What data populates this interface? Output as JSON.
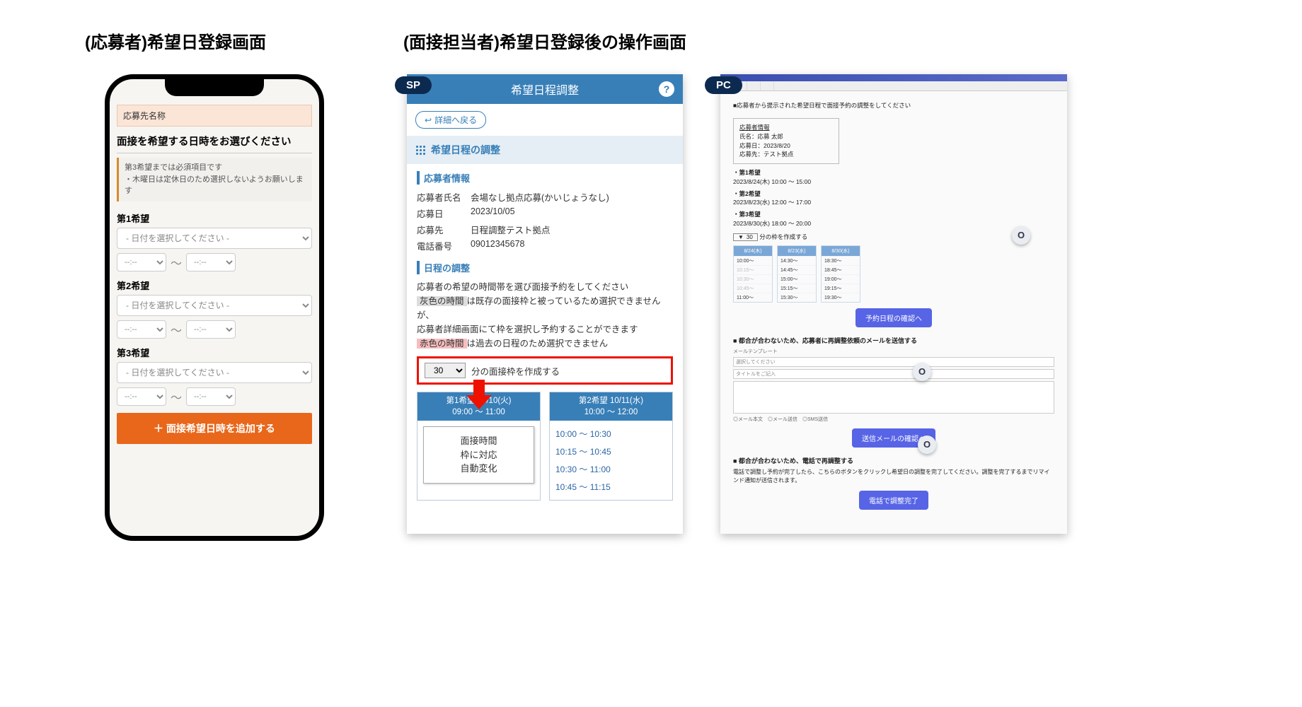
{
  "headings": {
    "left": "(応募者)希望日登録画面",
    "right": "(面接担当者)希望日登録後の操作画面"
  },
  "badges": {
    "sp": "SP",
    "pc": "PC"
  },
  "applicant_phone": {
    "dest_label": "応募先名称",
    "choose_title": "面接を希望する日時をお選びください",
    "notice_l1": "第3希望までは必須項目です",
    "notice_l2": "・木曜日は定休日のため選択しないようお願いします",
    "pref1": "第1希望",
    "pref2": "第2希望",
    "pref3": "第3希望",
    "date_placeholder": "- 日付を選択してください -",
    "time_placeholder": "--:--",
    "tilde": "～",
    "add_button": "＋ 面接希望日時を追加する"
  },
  "sp": {
    "header": "希望日程調整",
    "back": "詳細へ戻る",
    "section_title": "希望日程の調整",
    "h_applicant": "応募者情報",
    "rows": {
      "name_k": "応募者氏名",
      "name_v": "会場なし拠点応募(かいじょうなし)",
      "date_k": "応募日",
      "date_v": "2023/10/05",
      "dest_k": "応募先",
      "dest_v": "日程調整テスト拠点",
      "tel_k": "電話番号",
      "tel_v": "09012345678"
    },
    "h_sched": "日程の調整",
    "note1": "応募者の希望の時間帯を選び面接予約をしてください",
    "gray_label": "灰色の時間",
    "note2a": "は既存の面接枠と被っているため選択できませんが、",
    "note2b": "応募者詳細画面にて枠を選択し予約することができます",
    "red_label": "赤色の時間",
    "note3": "は過去の日程のため選択できません",
    "minute_value": "30",
    "minute_suffix": "分の面接枠を作成する",
    "card1_head_l1": "第1希望 10/10(火)",
    "card1_head_l2": "09:00 ～ 11:00",
    "auto_box": "面接時間\n枠に対応\n自動変化",
    "card2_head_l1": "第2希望 10/11(水)",
    "card2_head_l2": "10:00 ～ 12:00",
    "card2_slots": [
      "10:00 ～ 10:30",
      "10:15 ～ 10:45",
      "10:30 ～ 11:00",
      "10:45 ～ 11:15"
    ]
  },
  "pc": {
    "intro": "■応募者から提示された希望日程で面接予約の調整をしてください",
    "info_title": "応募者情報",
    "info_lines": [
      "氏名：応募 太郎",
      "応募日：2023/8/20",
      "応募先：テスト拠点"
    ],
    "wishes": [
      {
        "h": "・第1希望",
        "d": "2023/8/24(木) 10:00 ～ 15:00"
      },
      {
        "h": "・第2希望",
        "d": "2023/8/23(水) 12:00 ～ 17:00"
      },
      {
        "h": "・第3希望",
        "d": "2023/8/30(水) 18:00 ～ 20:00"
      }
    ],
    "minute_value": "30",
    "minute_suffix": "分の枠を作成する",
    "cols": [
      {
        "h": "8/24(木)",
        "t": [
          "10:00～",
          "10:15～",
          "10:30～",
          "10:45～",
          "11:00～"
        ],
        "dis": [
          1,
          2,
          3
        ]
      },
      {
        "h": "8/23(水)",
        "t": [
          "14:30～",
          "14:45～",
          "15:00～",
          "15:15～",
          "15:30～"
        ],
        "dis": []
      },
      {
        "h": "8/30(水)",
        "t": [
          "18:30～",
          "18:45～",
          "19:00～",
          "19:15～",
          "19:30～"
        ],
        "dis": []
      }
    ],
    "btn_confirm": "予約日程の確認へ",
    "mail_title": "■ 都合が合わないため、応募者に再調整依頼のメールを送信する",
    "mail_tmpl_label": "メールテンプレート",
    "mail_field1": "選択してください",
    "mail_field2": "タイトルをご記入",
    "mail_hints": "◎メール本文　◎メール送信　◎SMS送信",
    "btn_mail": "送信メールの確認へ",
    "phone_title": "■ 都合が合わないため、電話で再調整する",
    "phone_desc": "電話で調整し予約が完了したら、こちらのボタンをクリックし希望日の調整を完了してください。調整を完了するまでリマインド通知が送信されます。",
    "btn_phone": "電話で調整完了"
  },
  "callout": "O"
}
